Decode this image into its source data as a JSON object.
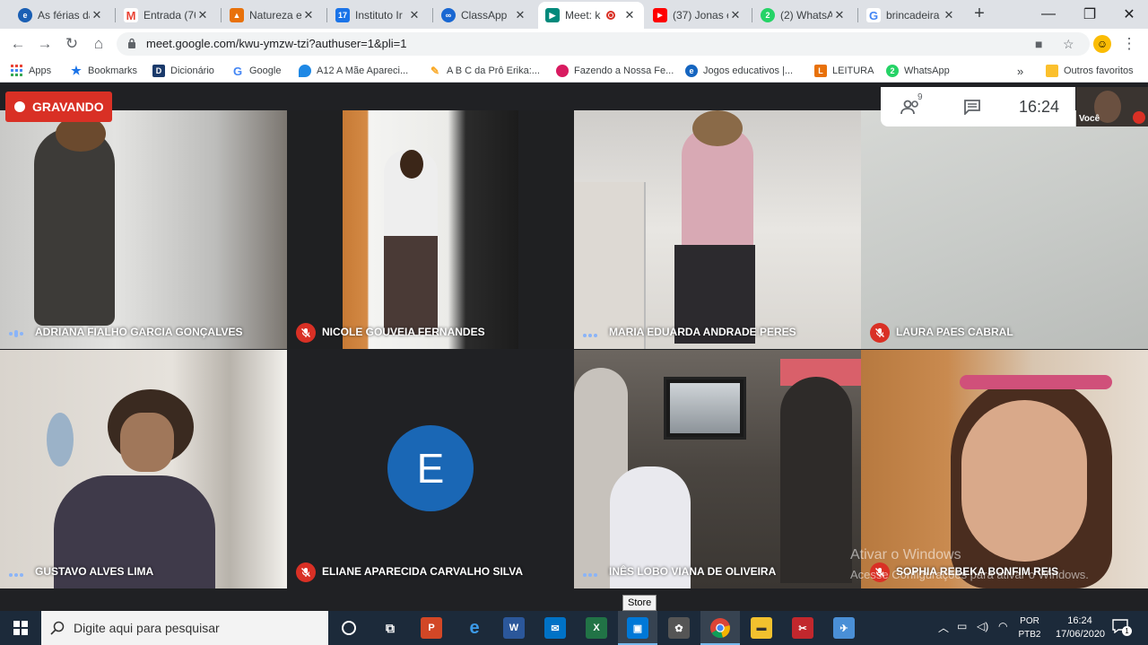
{
  "tabs": [
    {
      "label": "As férias da",
      "icon": "edge-icon",
      "color": "#1a5fb4"
    },
    {
      "label": "Entrada (76",
      "icon": "gmail-icon",
      "color": "#ea4335"
    },
    {
      "label": "Natureza e",
      "icon": "drive-doc-icon",
      "color": "#e8710a"
    },
    {
      "label": "Instituto Ir",
      "icon": "calendar-icon",
      "color": "#1a73e8"
    },
    {
      "label": "ClassApp",
      "icon": "classapp-icon",
      "color": "#1967d2"
    },
    {
      "label": "Meet: k",
      "icon": "meet-icon",
      "color": "#00897b"
    },
    {
      "label": "(37) Jonas e",
      "icon": "youtube-icon",
      "color": "#ff0000"
    },
    {
      "label": "(2) WhatsA",
      "icon": "whatsapp-icon",
      "color": "#25d366"
    },
    {
      "label": "brincadeira",
      "icon": "google-icon",
      "color": "#4285f4"
    }
  ],
  "browser": {
    "url": "meet.google.com/kwu-ymzw-tzi?authuser=1&pli=1"
  },
  "bookmarks": [
    {
      "label": "Apps",
      "icon": "apps-grid-icon",
      "color": "#4285f4"
    },
    {
      "label": "Bookmarks",
      "icon": "star-icon",
      "color": "#1a73e8"
    },
    {
      "label": "Dicionário",
      "icon": "dicionario-icon",
      "color": "#1a3a6b"
    },
    {
      "label": "Google",
      "icon": "google-icon",
      "color": "#4285f4"
    },
    {
      "label": "A12 A Mãe Apareci...",
      "icon": "drop-icon",
      "color": "#1e88e5"
    },
    {
      "label": "A B C da Prô Erika:...",
      "icon": "pencil-icon",
      "color": "#f9a825"
    },
    {
      "label": "Fazendo a Nossa Fe...",
      "icon": "cupcake-icon",
      "color": "#d81b60"
    },
    {
      "label": "Jogos educativos |...",
      "icon": "globe-icon",
      "color": "#1565c0"
    },
    {
      "label": "LEITURA",
      "icon": "leitura-icon",
      "color": "#e8710a"
    },
    {
      "label": "WhatsApp",
      "icon": "whatsapp-icon",
      "color": "#25d366"
    }
  ],
  "bookmarks_more": "»",
  "bookmarks_other": "Outros favoritos",
  "meet": {
    "recording_label": "GRAVANDO",
    "participants_count": "9",
    "clock": "16:24",
    "self_label": "Você",
    "avatar_letter": "E"
  },
  "participants": [
    {
      "name": "ADRIANA FIALHO GARCIA GONÇALVES",
      "muted": false
    },
    {
      "name": "NICOLE GOUVEIA FERNANDES",
      "muted": true
    },
    {
      "name": "MARIA EDUARDA ANDRADE PERES",
      "muted": false
    },
    {
      "name": "LAURA PAES CABRAL",
      "muted": true
    },
    {
      "name": "GUSTAVO ALVES LIMA",
      "muted": false
    },
    {
      "name": "ELIANE APARECIDA CARVALHO SILVA",
      "muted": true
    },
    {
      "name": "INÊS LOBO VIANA DE OLIVEIRA",
      "muted": false
    },
    {
      "name": "SOPHIA REBEKA BONFIM REIS",
      "muted": true
    }
  ],
  "watermark": {
    "line1": "Ativar o Windows",
    "line2": "Acesse Configurações para ativar o Windows."
  },
  "tooltip": "Store",
  "taskbar": {
    "search_placeholder": "Digite aqui para pesquisar",
    "lang": "POR",
    "layout": "PTB2",
    "time": "16:24",
    "date": "17/06/2020",
    "notifications": "1"
  }
}
